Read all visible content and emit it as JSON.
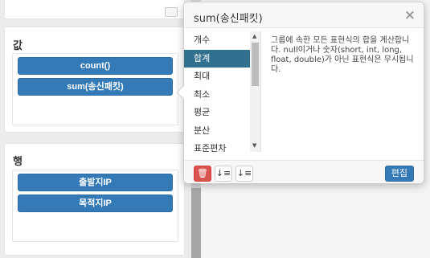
{
  "sections": {
    "values": {
      "title": "값",
      "pills": [
        "count()",
        "sum(송신패킷)"
      ]
    },
    "rows": {
      "title": "행",
      "pills": [
        "출발지IP",
        "목적지IP"
      ]
    }
  },
  "popover": {
    "title": "sum(송신패킷)",
    "close_icon": "×",
    "aggregations": [
      "개수",
      "합계",
      "최대",
      "최소",
      "평균",
      "분산",
      "표준편차"
    ],
    "selected_index": 1,
    "description": "그룹에 속한 모든 표현식의 합을 계산합니다. null이거나 숫자(short, int, long, float, double)가 아닌 표현식은 무시됩니다.",
    "footer": {
      "delete_icon": "🗑",
      "sort_asc_icon": "↓≡",
      "sort_desc_icon": "↓≡",
      "edit_label": "편집"
    }
  },
  "colors": {
    "pill": "#337ab7",
    "selected_item": "#31708f",
    "delete": "#d9534f"
  }
}
